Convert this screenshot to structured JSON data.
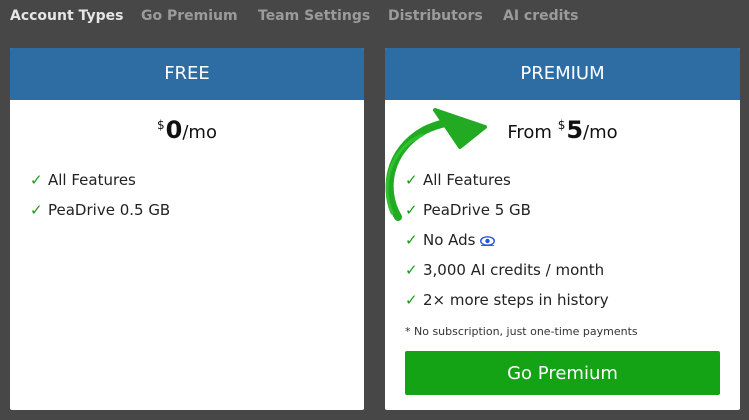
{
  "tabs": [
    {
      "label": "Account Types",
      "active": true
    },
    {
      "label": "Go Premium",
      "active": false
    },
    {
      "label": "Team Settings",
      "active": false
    },
    {
      "label": "Distributors",
      "active": false
    },
    {
      "label": "AI credits",
      "active": false
    }
  ],
  "colors": {
    "header_blue": "#2e6da4",
    "accent_green": "#14a314",
    "check_green": "#1a9b1a",
    "background": "#474747"
  },
  "free": {
    "title": "FREE",
    "currency": "$",
    "amount": "0",
    "period": "/mo",
    "features": [
      {
        "text": "All Features"
      },
      {
        "text": "PeaDrive 0.5 GB"
      }
    ]
  },
  "premium": {
    "title": "PREMIUM",
    "prefix": "From",
    "currency": "$",
    "amount": "5",
    "period": "/mo",
    "features": [
      {
        "text": "All Features"
      },
      {
        "text": "PeaDrive 5 GB"
      },
      {
        "text": "No Ads",
        "icon": "eye-icon"
      },
      {
        "text": "3,000 AI credits / month"
      },
      {
        "text": "2× more steps in history"
      }
    ],
    "note": "* No subscription, just one-time payments",
    "button_label": "Go Premium"
  },
  "check_glyph": "✓"
}
